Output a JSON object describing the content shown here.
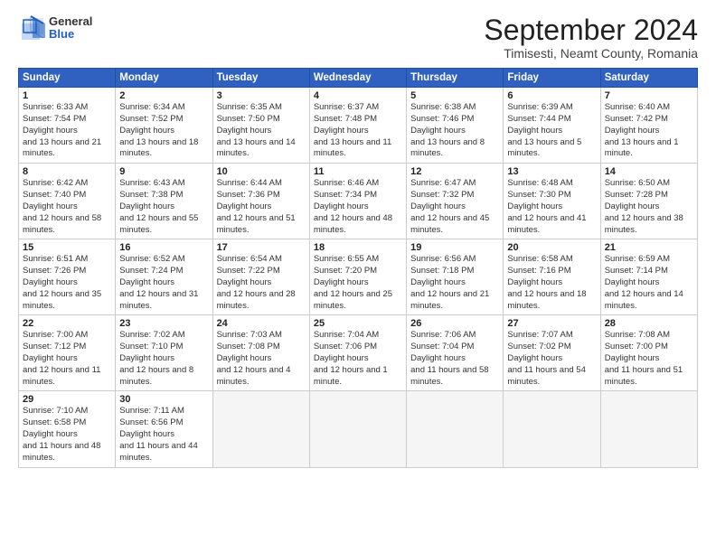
{
  "header": {
    "logo": {
      "line1": "General",
      "line2": "Blue"
    },
    "title": "September 2024",
    "location": "Timisesti, Neamt County, Romania"
  },
  "weekdays": [
    "Sunday",
    "Monday",
    "Tuesday",
    "Wednesday",
    "Thursday",
    "Friday",
    "Saturday"
  ],
  "weeks": [
    [
      {
        "day": 1,
        "sunrise": "6:33 AM",
        "sunset": "7:54 PM",
        "daylight": "13 hours and 21 minutes."
      },
      {
        "day": 2,
        "sunrise": "6:34 AM",
        "sunset": "7:52 PM",
        "daylight": "13 hours and 18 minutes."
      },
      {
        "day": 3,
        "sunrise": "6:35 AM",
        "sunset": "7:50 PM",
        "daylight": "13 hours and 14 minutes."
      },
      {
        "day": 4,
        "sunrise": "6:37 AM",
        "sunset": "7:48 PM",
        "daylight": "13 hours and 11 minutes."
      },
      {
        "day": 5,
        "sunrise": "6:38 AM",
        "sunset": "7:46 PM",
        "daylight": "13 hours and 8 minutes."
      },
      {
        "day": 6,
        "sunrise": "6:39 AM",
        "sunset": "7:44 PM",
        "daylight": "13 hours and 5 minutes."
      },
      {
        "day": 7,
        "sunrise": "6:40 AM",
        "sunset": "7:42 PM",
        "daylight": "13 hours and 1 minute."
      }
    ],
    [
      {
        "day": 8,
        "sunrise": "6:42 AM",
        "sunset": "7:40 PM",
        "daylight": "12 hours and 58 minutes."
      },
      {
        "day": 9,
        "sunrise": "6:43 AM",
        "sunset": "7:38 PM",
        "daylight": "12 hours and 55 minutes."
      },
      {
        "day": 10,
        "sunrise": "6:44 AM",
        "sunset": "7:36 PM",
        "daylight": "12 hours and 51 minutes."
      },
      {
        "day": 11,
        "sunrise": "6:46 AM",
        "sunset": "7:34 PM",
        "daylight": "12 hours and 48 minutes."
      },
      {
        "day": 12,
        "sunrise": "6:47 AM",
        "sunset": "7:32 PM",
        "daylight": "12 hours and 45 minutes."
      },
      {
        "day": 13,
        "sunrise": "6:48 AM",
        "sunset": "7:30 PM",
        "daylight": "12 hours and 41 minutes."
      },
      {
        "day": 14,
        "sunrise": "6:50 AM",
        "sunset": "7:28 PM",
        "daylight": "12 hours and 38 minutes."
      }
    ],
    [
      {
        "day": 15,
        "sunrise": "6:51 AM",
        "sunset": "7:26 PM",
        "daylight": "12 hours and 35 minutes."
      },
      {
        "day": 16,
        "sunrise": "6:52 AM",
        "sunset": "7:24 PM",
        "daylight": "12 hours and 31 minutes."
      },
      {
        "day": 17,
        "sunrise": "6:54 AM",
        "sunset": "7:22 PM",
        "daylight": "12 hours and 28 minutes."
      },
      {
        "day": 18,
        "sunrise": "6:55 AM",
        "sunset": "7:20 PM",
        "daylight": "12 hours and 25 minutes."
      },
      {
        "day": 19,
        "sunrise": "6:56 AM",
        "sunset": "7:18 PM",
        "daylight": "12 hours and 21 minutes."
      },
      {
        "day": 20,
        "sunrise": "6:58 AM",
        "sunset": "7:16 PM",
        "daylight": "12 hours and 18 minutes."
      },
      {
        "day": 21,
        "sunrise": "6:59 AM",
        "sunset": "7:14 PM",
        "daylight": "12 hours and 14 minutes."
      }
    ],
    [
      {
        "day": 22,
        "sunrise": "7:00 AM",
        "sunset": "7:12 PM",
        "daylight": "12 hours and 11 minutes."
      },
      {
        "day": 23,
        "sunrise": "7:02 AM",
        "sunset": "7:10 PM",
        "daylight": "12 hours and 8 minutes."
      },
      {
        "day": 24,
        "sunrise": "7:03 AM",
        "sunset": "7:08 PM",
        "daylight": "12 hours and 4 minutes."
      },
      {
        "day": 25,
        "sunrise": "7:04 AM",
        "sunset": "7:06 PM",
        "daylight": "12 hours and 1 minute."
      },
      {
        "day": 26,
        "sunrise": "7:06 AM",
        "sunset": "7:04 PM",
        "daylight": "11 hours and 58 minutes."
      },
      {
        "day": 27,
        "sunrise": "7:07 AM",
        "sunset": "7:02 PM",
        "daylight": "11 hours and 54 minutes."
      },
      {
        "day": 28,
        "sunrise": "7:08 AM",
        "sunset": "7:00 PM",
        "daylight": "11 hours and 51 minutes."
      }
    ],
    [
      {
        "day": 29,
        "sunrise": "7:10 AM",
        "sunset": "6:58 PM",
        "daylight": "11 hours and 48 minutes."
      },
      {
        "day": 30,
        "sunrise": "7:11 AM",
        "sunset": "6:56 PM",
        "daylight": "11 hours and 44 minutes."
      },
      null,
      null,
      null,
      null,
      null
    ]
  ]
}
